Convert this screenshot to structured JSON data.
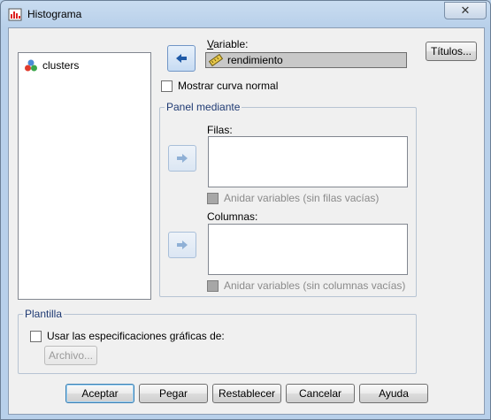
{
  "window": {
    "title": "Histograma",
    "close_label": "✕"
  },
  "variables_list": {
    "items": [
      {
        "label": "clusters",
        "icon": "nominal-variable-icon"
      }
    ]
  },
  "variable": {
    "label_prefix": "V",
    "label_rest": "ariable:",
    "value": "rendimiento",
    "value_icon": "scale-variable-icon"
  },
  "normal_curve": {
    "label": "Mostrar curva normal",
    "checked": false
  },
  "panel": {
    "title": "Panel mediante",
    "rows_label": "Filas:",
    "rows_nest_label": "Anidar variables (sin filas vacías)",
    "columns_label": "Columnas:",
    "columns_nest_label": "Anidar variables (sin columnas vacías)"
  },
  "template": {
    "title": "Plantilla",
    "use_spec_label": "Usar las especificaciones gráficas de:",
    "file_button": "Archivo..."
  },
  "buttons": {
    "titles": "Títulos...",
    "accept": "Aceptar",
    "paste": "Pegar",
    "reset": "Restablecer",
    "cancel": "Cancelar",
    "help": "Ayuda"
  },
  "colors": {
    "accent": "#3c7fb1",
    "arrow_active": "#1e5aa8",
    "arrow_disabled": "#8fb0d6"
  }
}
